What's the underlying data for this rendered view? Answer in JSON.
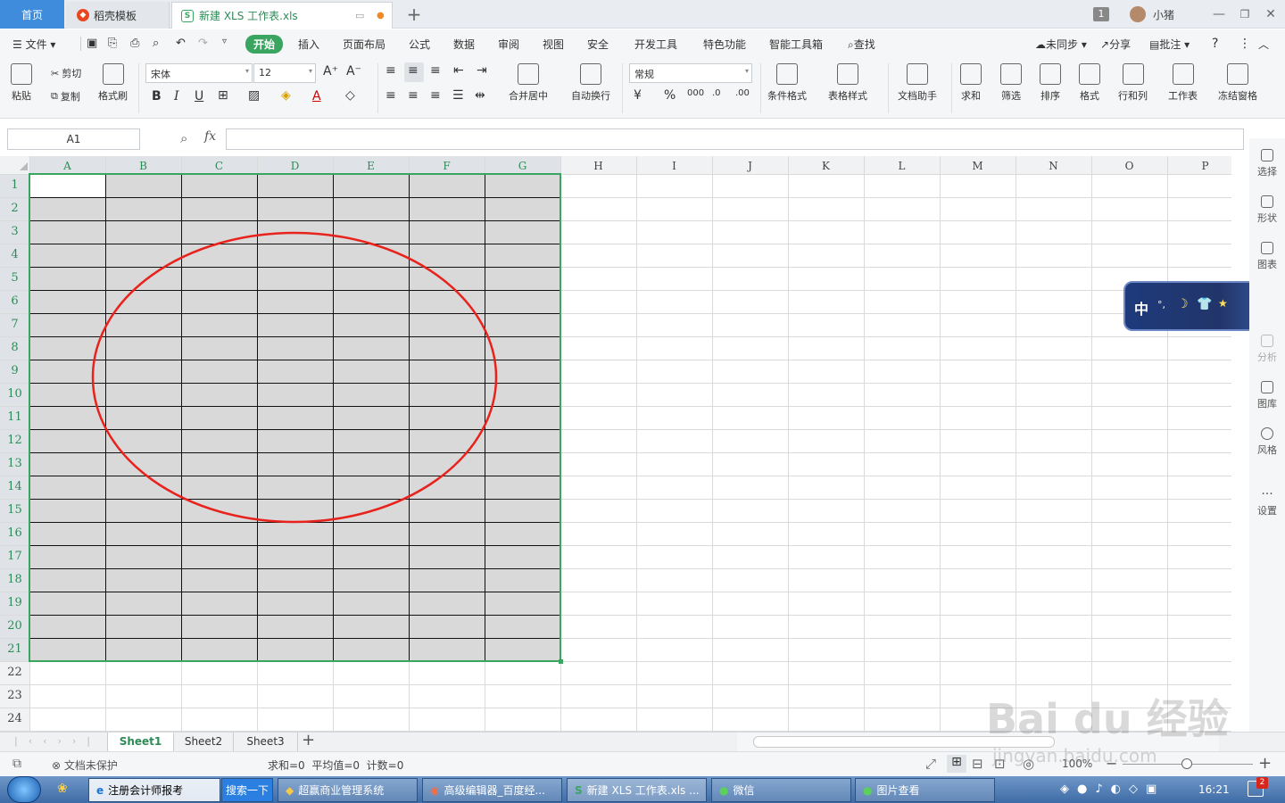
{
  "titlebar": {
    "tab_home": "首页",
    "tab_draft": "稻壳模板",
    "tab_doc": "新建 XLS 工作表.xls",
    "badge": "1",
    "user": "小猪"
  },
  "menu": {
    "file": "文件",
    "items": [
      "开始",
      "插入",
      "页面布局",
      "公式",
      "数据",
      "审阅",
      "视图",
      "安全",
      "开发工具",
      "特色功能",
      "智能工具箱"
    ],
    "search": "查找",
    "sync": "未同步",
    "share": "分享",
    "comment": "批注"
  },
  "ribbon": {
    "paste": "粘贴",
    "cut": "剪切",
    "copy": "复制",
    "format_painter": "格式刷",
    "font_name": "宋体",
    "font_size": "12",
    "merge_center": "合并居中",
    "auto_wrap": "自动换行",
    "number_format": "常规",
    "cond_format": "条件格式",
    "table_style": "表格样式",
    "doc_assistant": "文档助手",
    "sum": "求和",
    "filter": "筛选",
    "sort": "排序",
    "format": "格式",
    "row_col": "行和列",
    "worksheet": "工作表",
    "freeze": "冻结窗格"
  },
  "formula_bar": {
    "name_box": "A1",
    "fx": "fx",
    "value": ""
  },
  "grid": {
    "columns": [
      "A",
      "B",
      "C",
      "D",
      "E",
      "F",
      "G",
      "H",
      "I",
      "J",
      "K",
      "L",
      "M",
      "N",
      "O",
      "P"
    ],
    "rows": [
      "1",
      "2",
      "3",
      "4",
      "5",
      "6",
      "7",
      "8",
      "9",
      "10",
      "11",
      "12",
      "13",
      "14",
      "15",
      "16",
      "17",
      "18",
      "19",
      "20",
      "21",
      "22",
      "23",
      "24"
    ],
    "selection": "A1:G21",
    "selection_fill": "#d9d9d9",
    "selection_border": "#3aa561",
    "annotation_color": "#e8221c"
  },
  "right_panel": [
    "选择",
    "形状",
    "图表",
    "分析",
    "图库",
    "风格",
    "设置"
  ],
  "ime": {
    "label": "中"
  },
  "sheets": [
    "Sheet1",
    "Sheet2",
    "Sheet3"
  ],
  "status": {
    "protect": "文档未保护",
    "stats": "求和=0  平均值=0  计数=0",
    "zoom": "100%"
  },
  "taskbar": {
    "items": [
      "注册会计师报考",
      "搜索一下",
      "超赢商业管理系统",
      "高级编辑器_百度经...",
      "新建 XLS 工作表.xls ...",
      "微信",
      "图片查看"
    ],
    "time": "16:21",
    "notify": "2"
  },
  "watermark": {
    "brand": "Bai du 经验",
    "url": "jingyan.baidu.com"
  }
}
